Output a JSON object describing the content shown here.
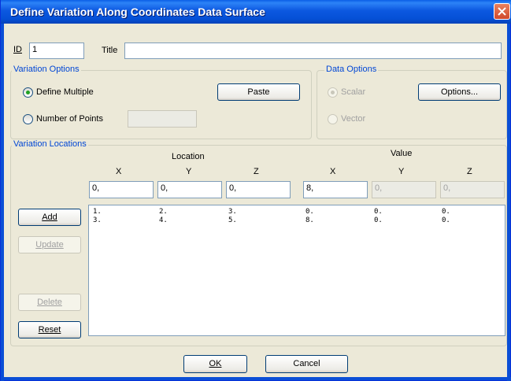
{
  "window": {
    "title": "Define Variation Along Coordinates Data Surface"
  },
  "id_label": "ID",
  "id_value": "1",
  "title_label": "Title",
  "title_value": "",
  "variation_options": {
    "group_label": "Variation Options",
    "define_multiple_label": "Define Multiple",
    "define_multiple_selected": true,
    "number_of_points_label": "Number of Points",
    "number_of_points_value": "",
    "paste_label": "Paste"
  },
  "data_options": {
    "group_label": "Data Options",
    "scalar_label": "Scalar",
    "scalar_selected": true,
    "vector_label": "Vector",
    "options_label": "Options..."
  },
  "variation_locations": {
    "group_label": "Variation Locations",
    "location_header": "Location",
    "value_header": "Value",
    "columns": [
      "X",
      "Y",
      "Z",
      "X",
      "Y",
      "Z"
    ],
    "inputs": [
      "0,",
      "0,",
      "0,",
      "8,",
      "0,",
      "0,"
    ],
    "inputs_enabled": [
      true,
      true,
      true,
      true,
      false,
      false
    ],
    "rows": [
      [
        "1.",
        "2.",
        "3.",
        "0.",
        "0.",
        "0."
      ],
      [
        "3.",
        "4.",
        "5.",
        "8.",
        "0.",
        "0."
      ]
    ]
  },
  "buttons": {
    "add": "Add",
    "update": "Update",
    "delete": "Delete",
    "reset": "Reset",
    "ok": "OK",
    "cancel": "Cancel"
  }
}
